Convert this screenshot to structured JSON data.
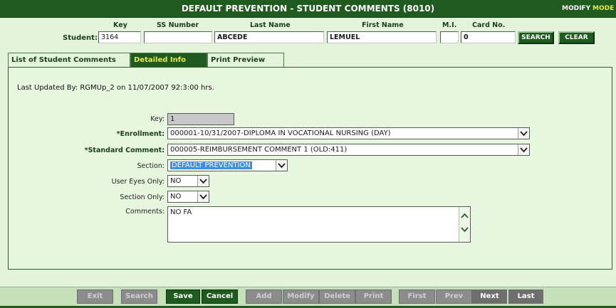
{
  "titlebar": {
    "title": "DEFAULT PREVENTION - STUDENT COMMENTS (8010)",
    "mode_label": "MODIFY",
    "mode_value": "MODE"
  },
  "student": {
    "label": "Student:",
    "headers": {
      "key": "Key",
      "ss_number": "SS Number",
      "last_name": "Last Name",
      "first_name": "First Name",
      "mi": "M.I.",
      "card_no": "Card No."
    },
    "values": {
      "key": "3164",
      "ss_number": "",
      "last_name": "ABCEDE",
      "first_name": "LEMUEL",
      "mi": "",
      "card_no": "0"
    },
    "search_label": "SEARCH",
    "clear_label": "CLEAR"
  },
  "tabs": {
    "list": "List of Student Comments",
    "detailed": "Detailed Info",
    "print": "Print Preview"
  },
  "detail": {
    "last_updated": "Last Updated By: RGMUp_2 on 11/07/2007 92:3:00 hrs.",
    "labels": {
      "key": "Key:",
      "enrollment": "*Enrollment:",
      "standard_comment": "*Standard Comment:",
      "section": "Section:",
      "user_eyes_only": "User Eyes Only:",
      "section_only": "Section Only:",
      "comments": "Comments:"
    },
    "values": {
      "key": "1",
      "enrollment": "000001-10/31/2007-DIPLOMA IN VOCATIONAL NURSING (DAY)",
      "standard_comment": "000005-REIMBURSEMENT COMMENT 1 (OLD:411)",
      "section": "DEFAULT PREVENTION",
      "user_eyes_only": "NO",
      "section_only": "NO",
      "comments": "NO FA"
    }
  },
  "footer": {
    "exit": "Exit",
    "search": "Search",
    "save": "Save",
    "cancel": "Cancel",
    "add": "Add",
    "modify": "Modify",
    "delete": "Delete",
    "print": "Print",
    "first": "First",
    "prev": "Prev",
    "next": "Next",
    "last": "Last"
  },
  "colors": {
    "brand_green": "#1f5a1f",
    "background": "#e4f4dc",
    "mode_yellow": "#e8e84a",
    "selection_blue": "#3a8fe8"
  },
  "icons": {
    "dropdown": "chevron-down-icon",
    "scroll_up": "chevron-up-icon",
    "scroll_down": "chevron-down-icon"
  }
}
